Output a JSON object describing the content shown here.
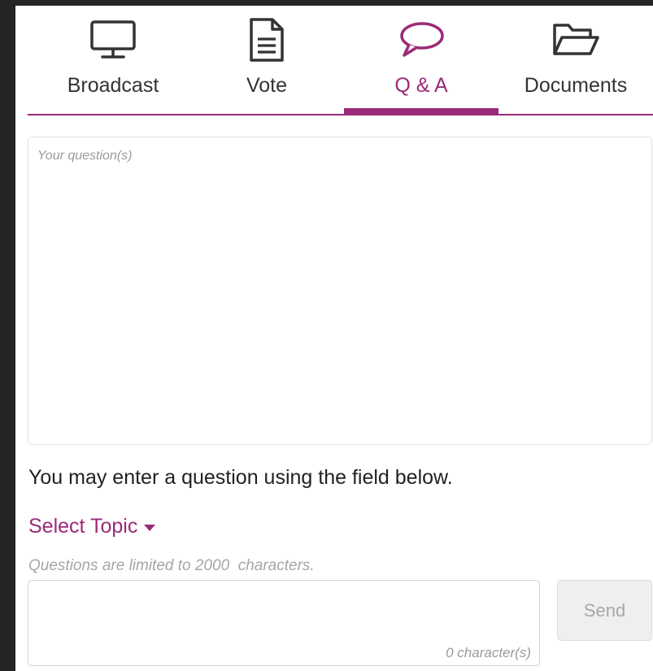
{
  "tabs": [
    {
      "label": "Broadcast",
      "icon": "monitor-icon",
      "active": false
    },
    {
      "label": "Vote",
      "icon": "document-icon",
      "active": false
    },
    {
      "label": "Q & A",
      "icon": "speech-bubble-icon",
      "active": true
    },
    {
      "label": "Documents",
      "icon": "folder-open-icon",
      "active": false
    }
  ],
  "colors": {
    "accent": "#9b2a78",
    "text": "#333333",
    "muted": "#9a9a9a"
  },
  "history": {
    "placeholder": "Your question(s)"
  },
  "instruction": "You may enter a question using the field below.",
  "topic": {
    "label": "Select Topic"
  },
  "question": {
    "limit_text": "Questions are limited to 2000  characters.",
    "value": "",
    "char_count": "0 character(s)",
    "send_label": "Send"
  }
}
